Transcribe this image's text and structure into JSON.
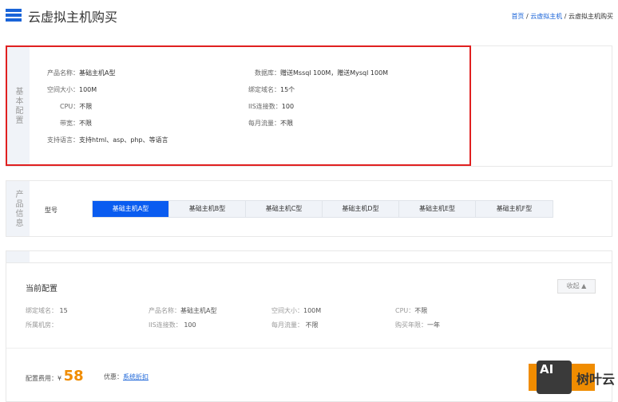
{
  "header": {
    "title": "云虚拟主机购买",
    "breadcrumb": [
      "首页",
      "云虚拟主机",
      "云虚拟主机购买"
    ]
  },
  "basic": {
    "side_label": "基本配置",
    "items": [
      {
        "k": "产品名称：",
        "v": "基础主机A型"
      },
      {
        "k": "数据库：",
        "v": "赠送Mssql 100M，赠送Mysql 100M"
      },
      {
        "k": "空间大小：",
        "v": "100M"
      },
      {
        "k": "绑定域名：",
        "v": "15个"
      },
      {
        "k": "CPU：",
        "v": "不限"
      },
      {
        "k": "IIS连接数：",
        "v": "100"
      },
      {
        "k": "带宽：",
        "v": "不限"
      },
      {
        "k": "每月流量：",
        "v": "不限"
      },
      {
        "k": "支持语言：",
        "v": "支持html、asp、php、等语言"
      }
    ]
  },
  "product": {
    "side_label": "产品信息",
    "model_label": "型号",
    "tabs": [
      "基础主机A型",
      "基础主机B型",
      "基础主机C型",
      "基础主机D型",
      "基础主机E型",
      "基础主机F型"
    ],
    "active": 0
  },
  "current": {
    "title": "当前配置",
    "collapse": "收起 ▲",
    "items": [
      {
        "k": "绑定域名：",
        "v": "15"
      },
      {
        "k": "产品名称：",
        "v": "基础主机A型"
      },
      {
        "k": "空间大小：",
        "v": "100M"
      },
      {
        "k": "CPU：",
        "v": "不限"
      },
      {
        "k": "所属机房：",
        "v": ""
      },
      {
        "k": "IIS连接数：",
        "v": "100"
      },
      {
        "k": "每月流量：",
        "v": "不限"
      },
      {
        "k": "购买年限：",
        "v": "一年"
      }
    ],
    "fee_label": "配置费用：",
    "currency": "¥",
    "price": "58",
    "discount_label": "优惠：",
    "discount_value": "系统折扣"
  },
  "watermark": {
    "logo": "AI",
    "text": "树叶云"
  },
  "colors": {
    "accent": "#0a5cf0",
    "price": "#f08c00",
    "highlight": "#e02020"
  }
}
